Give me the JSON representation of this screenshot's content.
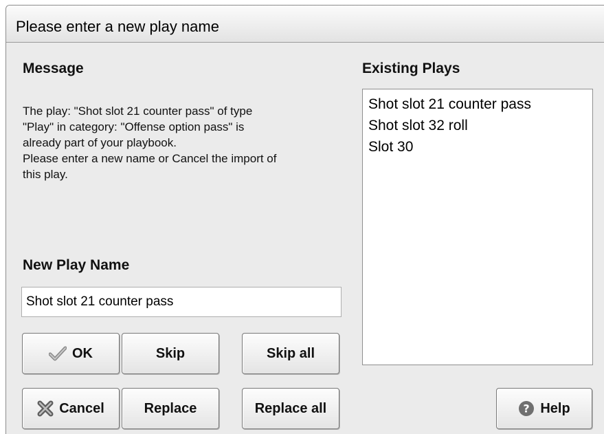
{
  "dialog": {
    "title": "Please enter a new play name"
  },
  "message_section": {
    "heading": "Message",
    "text": "The play: \"Shot slot 21 counter pass\" of type\n\"Play\" in category: \"Offense option pass\" is\nalready part of your playbook.\nPlease enter a new name or Cancel the import of\nthis play."
  },
  "new_name_section": {
    "heading": "New Play Name",
    "value": "Shot slot 21 counter pass"
  },
  "existing_plays": {
    "heading": "Existing Plays",
    "items": [
      "Shot slot 21 counter pass",
      "Shot slot 32 roll",
      "Slot 30"
    ]
  },
  "buttons": {
    "ok": "OK",
    "skip": "Skip",
    "skip_all": "Skip all",
    "cancel": "Cancel",
    "replace": "Replace",
    "replace_all": "Replace all",
    "help": "Help"
  },
  "icons": {
    "ok": "checkmark-icon",
    "cancel": "x-icon",
    "help": "question-icon"
  }
}
